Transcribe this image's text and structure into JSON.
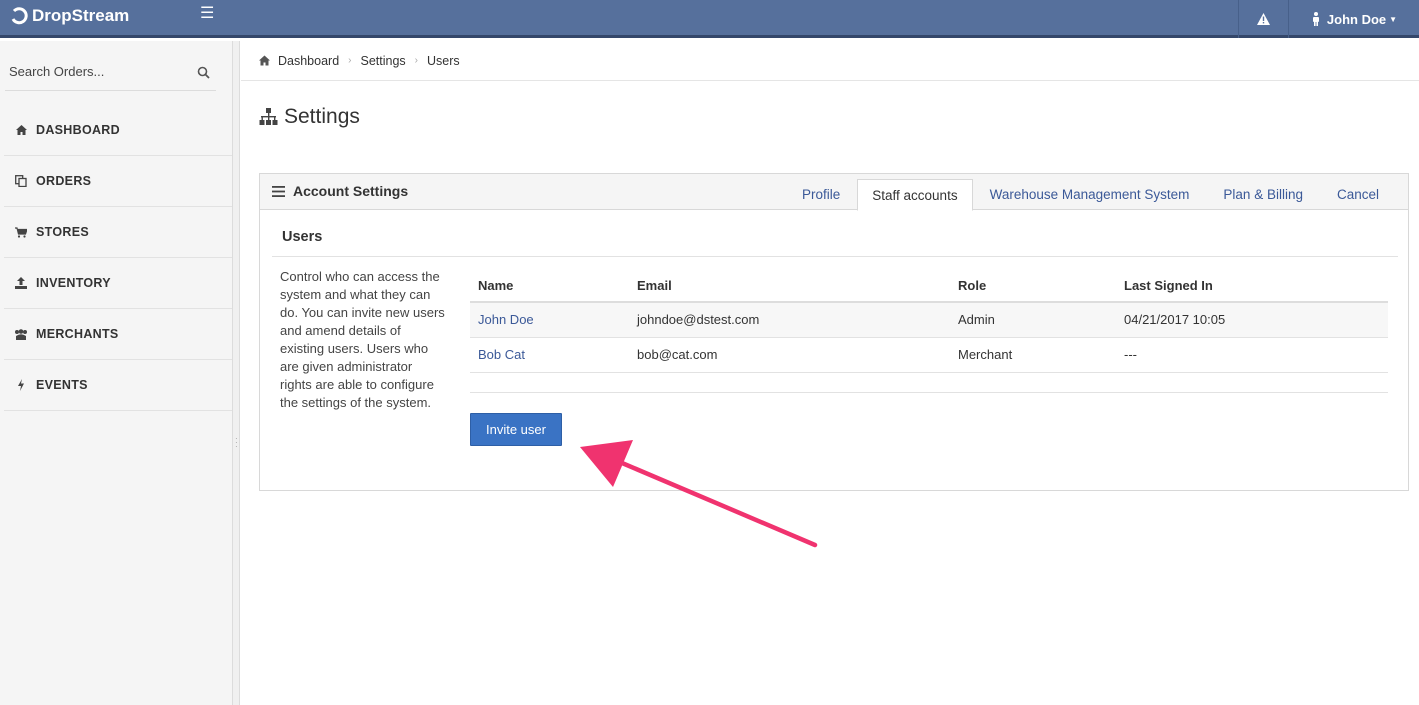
{
  "app": {
    "brand": "DropStream",
    "brand_color": "#56709c",
    "user_name": "John Doe"
  },
  "sidebar": {
    "search_placeholder": "Search Orders...",
    "items": [
      {
        "label": "DASHBOARD",
        "icon": "home-icon"
      },
      {
        "label": "ORDERS",
        "icon": "copy-icon"
      },
      {
        "label": "STORES",
        "icon": "cart-icon"
      },
      {
        "label": "INVENTORY",
        "icon": "upload-icon"
      },
      {
        "label": "MERCHANTS",
        "icon": "users-icon"
      },
      {
        "label": "EVENTS",
        "icon": "bolt-icon"
      }
    ]
  },
  "breadcrumb": [
    "Dashboard",
    "Settings",
    "Users"
  ],
  "page": {
    "title": "Settings"
  },
  "panel": {
    "title": "Account Settings",
    "tabs": [
      "Profile",
      "Staff accounts",
      "Warehouse Management System",
      "Plan & Billing",
      "Cancel"
    ],
    "active_tab": "Staff accounts",
    "section_title": "Users",
    "description": "Control who can access the system and what they can do. You can invite new users and amend details of existing users. Users who are given administrator rights are able to configure the settings of the system.",
    "table": {
      "columns": [
        "Name",
        "Email",
        "Role",
        "Last Signed In"
      ],
      "rows": [
        {
          "name": "John Doe",
          "email": "johndoe@dstest.com",
          "role": "Admin",
          "last_signed_in": "04/21/2017 10:05"
        },
        {
          "name": "Bob Cat",
          "email": "bob@cat.com",
          "role": "Merchant",
          "last_signed_in": "---"
        }
      ]
    },
    "invite_label": "Invite user",
    "invite_color": "#3a73c4"
  },
  "annotation": {
    "arrow_color": "#f0336f"
  }
}
